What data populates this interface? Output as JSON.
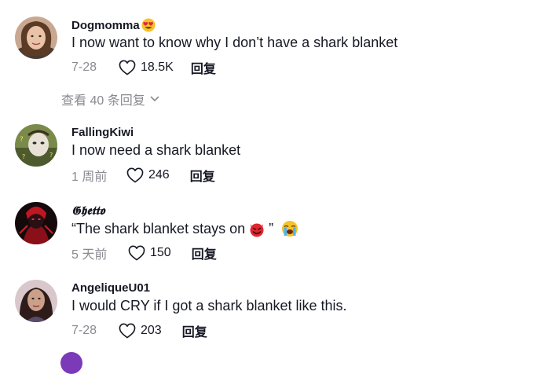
{
  "view_more_label": "查看 40 条回复",
  "comments": [
    {
      "username": "Dogmomma",
      "text": "I now want to know why I don’t have a shark blanket",
      "date": "7-28",
      "likes": "18.5K",
      "reply_label": "回复"
    },
    {
      "username": "FallingKiwi",
      "text": "I now need a shark blanket",
      "date": "1 周前",
      "likes": "246",
      "reply_label": "回复"
    },
    {
      "username": "𝕲𝖍𝖊𝖙𝖙𝖔",
      "text": "“The shark blanket stays on",
      "text_tail": "”",
      "date": "5 天前",
      "likes": "150",
      "reply_label": "回复"
    },
    {
      "username": "AngeliqueU01",
      "text": "I would CRY if I got a shark blanket like this.",
      "date": "7-28",
      "likes": "203",
      "reply_label": "回复"
    }
  ],
  "icons": {
    "like": "heart-outline-icon",
    "expand": "chevron-down-icon",
    "username_emoji": "heart-eyes-emoji-icon",
    "devil_emoji": "smiling-devil-emoji-icon",
    "crying_emoji": "loudly-crying-emoji-icon"
  },
  "colors": {
    "text_primary": "#161823",
    "text_secondary": "#8a8b91"
  }
}
